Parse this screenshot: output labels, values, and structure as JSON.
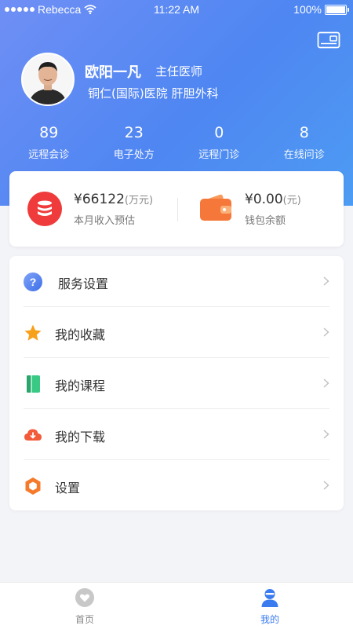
{
  "status_bar": {
    "carrier": "Rebecca",
    "time": "11:22 AM",
    "battery": "100%"
  },
  "profile": {
    "name": "欧阳一凡",
    "title": "主任医师",
    "hospital": "铜仁(国际)医院 肝胆外科"
  },
  "stats": [
    {
      "value": "89",
      "label": "远程会诊"
    },
    {
      "value": "23",
      "label": "电子处方"
    },
    {
      "value": "0",
      "label": "远程门诊"
    },
    {
      "value": "8",
      "label": "在线问诊"
    }
  ],
  "income": {
    "monthly_value": "¥66122",
    "monthly_unit": "(万元)",
    "monthly_label": "本月收入预估",
    "wallet_value": "¥0.00",
    "wallet_unit": "(元)",
    "wallet_label": "钱包余额"
  },
  "menu": [
    {
      "label": "服务设置",
      "icon": "question-icon"
    },
    {
      "label": "我的收藏",
      "icon": "star-icon"
    },
    {
      "label": "我的课程",
      "icon": "book-icon"
    },
    {
      "label": "我的下载",
      "icon": "cloud-download-icon"
    },
    {
      "label": "设置",
      "icon": "hexagon-settings-icon"
    }
  ],
  "tabs": [
    {
      "label": "首页",
      "icon": "heart-icon",
      "active": false
    },
    {
      "label": "我的",
      "icon": "user-icon",
      "active": true
    }
  ],
  "colors": {
    "header_start": "#6f8ff5",
    "header_end": "#4d9cf3",
    "accent": "#3a7bf0",
    "income_icon": "#ef3b3b",
    "wallet_icon": "#f5783a",
    "star": "#f7a01a",
    "book": "#38c985",
    "download": "#f25a3a",
    "settings_hex": "#f57a2b"
  }
}
